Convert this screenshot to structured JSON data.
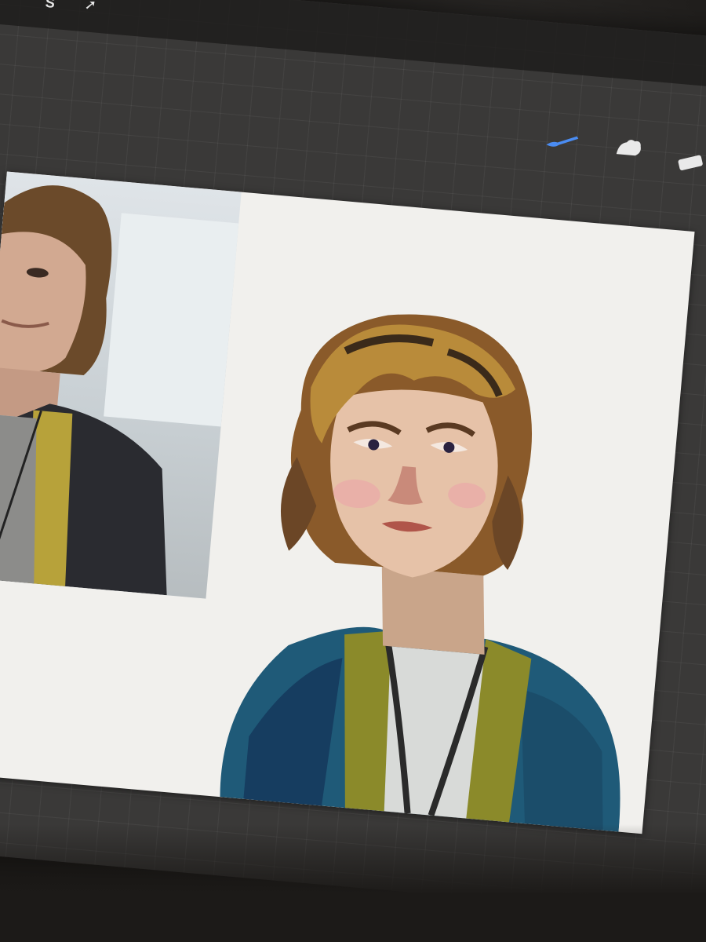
{
  "toolbar": {
    "left_tools": [
      {
        "name": "selection-icon",
        "glyph": "S"
      },
      {
        "name": "transform-arrow-icon",
        "glyph": "➚"
      }
    ],
    "right_tools": [
      {
        "name": "brush-icon",
        "active": true
      },
      {
        "name": "smudge-icon",
        "active": false
      },
      {
        "name": "eraser-icon",
        "active": false
      }
    ]
  },
  "colors": {
    "active_tool": "#4a8cf2",
    "canvas": "#f1f0ed",
    "hair": "#b98b3a",
    "skin": "#e6c2a8",
    "jacket": "#1f5a78",
    "shirt_collar": "#8b8a2a"
  }
}
